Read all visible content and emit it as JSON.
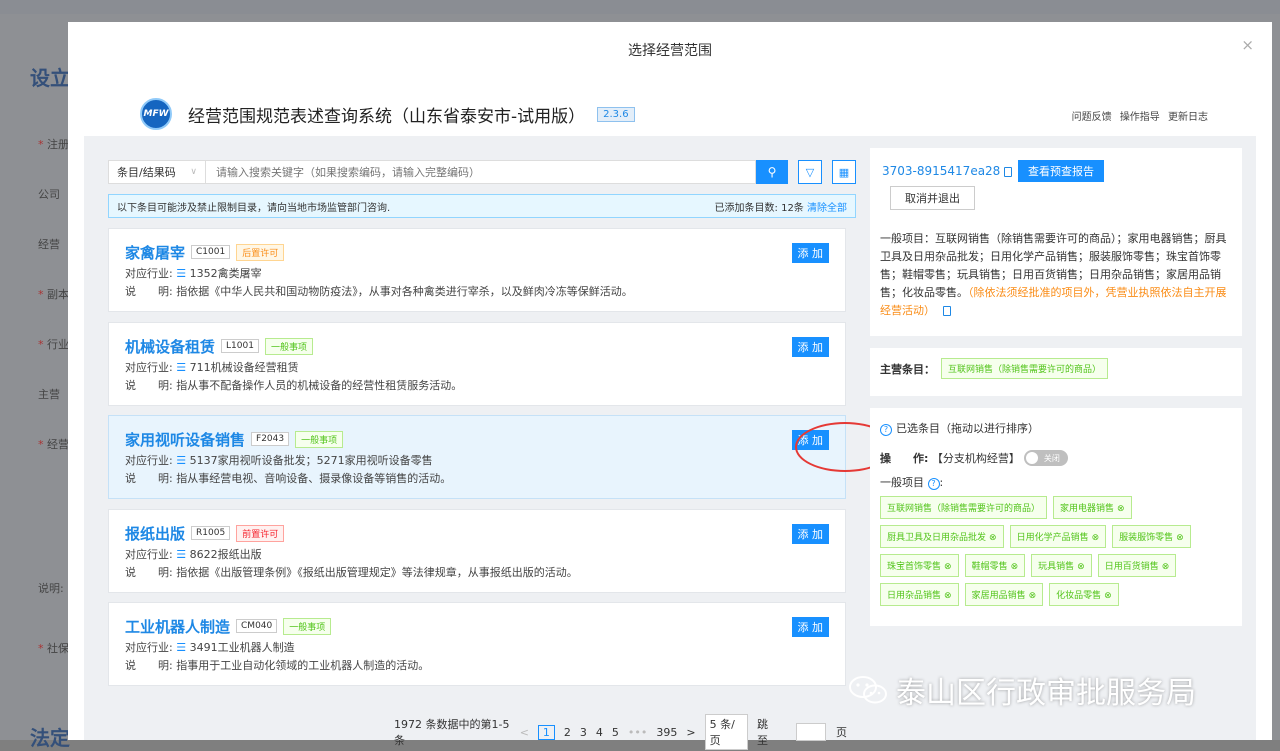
{
  "background": {
    "title": "设立",
    "bottom": "法定",
    "labels": [
      "注册",
      "公司",
      "经营",
      "副本",
      "行业",
      "主营",
      "经营",
      "说明:",
      "社保"
    ]
  },
  "modal": {
    "title": "选择经营范围",
    "close": "×"
  },
  "brand": {
    "logo_text": "MFW",
    "title": "经营范围规范表述查询系统（山东省泰安市-试用版）",
    "version": "2.3.6"
  },
  "toplinks": [
    "问题反馈",
    "操作指导",
    "更新日志"
  ],
  "search": {
    "select_label": "条目/结果码",
    "placeholder": "请输入搜索关键字（如果搜索编码，请输入完整编码）"
  },
  "notice": {
    "text": "以下条目可能涉及禁止限制目录，请向当地市场监管部门咨询.",
    "added": "已添加条目数: 12条",
    "clear": "清除全部"
  },
  "cards": [
    {
      "name": "家禽屠宰",
      "code": "C1001",
      "tag": "后置许可",
      "industry": "1352禽类屠宰",
      "desc": "指依据《中华人民共和国动物防疫法》，从事对各种禽类进行宰杀，以及鲜肉冷冻等保鲜活动。"
    },
    {
      "name": "机械设备租赁",
      "code": "L1001",
      "tag": "一般事项",
      "industry": "711机械设备经营租赁",
      "desc": "指从事不配备操作人员的机械设备的经营性租赁服务活动。"
    },
    {
      "name": "家用视听设备销售",
      "code": "F2043",
      "tag": "一般事项",
      "industry": "5137家用视听设备批发；5271家用视听设备零售",
      "desc": "指从事经营电视、音响设备、摄录像设备等销售的活动。"
    },
    {
      "name": "报纸出版",
      "code": "R1005",
      "tag": "前置许可",
      "industry": "8622报纸出版",
      "desc": "指依据《出版管理条例》《报纸出版管理规定》等法律规章，从事报纸出版的活动。"
    },
    {
      "name": "工业机器人制造",
      "code": "CM040",
      "tag": "一般事项",
      "industry": "3491工业机器人制造",
      "desc": "指事用于工业自动化领域的工业机器人制造的活动。"
    }
  ],
  "card_labels": {
    "industry": "对应行业:",
    "desc_prefix": "说　　明:",
    "add": "添 加"
  },
  "pager": {
    "summary": "1972 条数据中的第1-5条",
    "prev": "<",
    "pages": [
      "1",
      "2",
      "3",
      "4",
      "5",
      "•••",
      "395"
    ],
    "next": ">",
    "page_size": "5 条/页",
    "jump": "跳至",
    "page_unit": "页"
  },
  "right": {
    "uid": "3703-8915417ea28",
    "report_btn": "查看预查报告",
    "cancel_btn": "取消并退出",
    "scope_text": "一般项目：互联网销售（除销售需要许可的商品）；家用电器销售；厨具卫具及日用杂品批发；日用化学产品销售；服装服饰零售；珠宝首饰零售；鞋帽零售；玩具销售；日用百货销售；日用杂品销售；家居用品销售；化妆品零售。",
    "scope_note": "（除依法须经批准的项目外，凭营业执照依法自主开展经营活动）",
    "main_label": "主营条目：",
    "main_item": "互联网销售（除销售需要许可的商品）",
    "selected_title": "已选条目（拖动以进行排序）",
    "op_label": "操　　作:",
    "op_text": "【分支机构经营】",
    "toggle": "关闭",
    "general_label": "一般项目",
    "chip_main": "互联网销售（除销售需要许可的商品）",
    "chips": [
      "家用电器销售",
      "厨具卫具及日用杂品批发",
      "日用化学产品销售",
      "服装服饰零售",
      "珠宝首饰零售",
      "鞋帽零售",
      "玩具销售",
      "日用百货销售",
      "日用杂品销售",
      "家居用品销售",
      "化妆品零售"
    ]
  },
  "watermark": "泰山区行政审批服务局",
  "colors": {
    "primary": "#1890ff",
    "tag_green": "#52c41a",
    "tag_orange": "#fa8c16",
    "tag_red": "#f5222d",
    "annotation": "#e53935"
  }
}
